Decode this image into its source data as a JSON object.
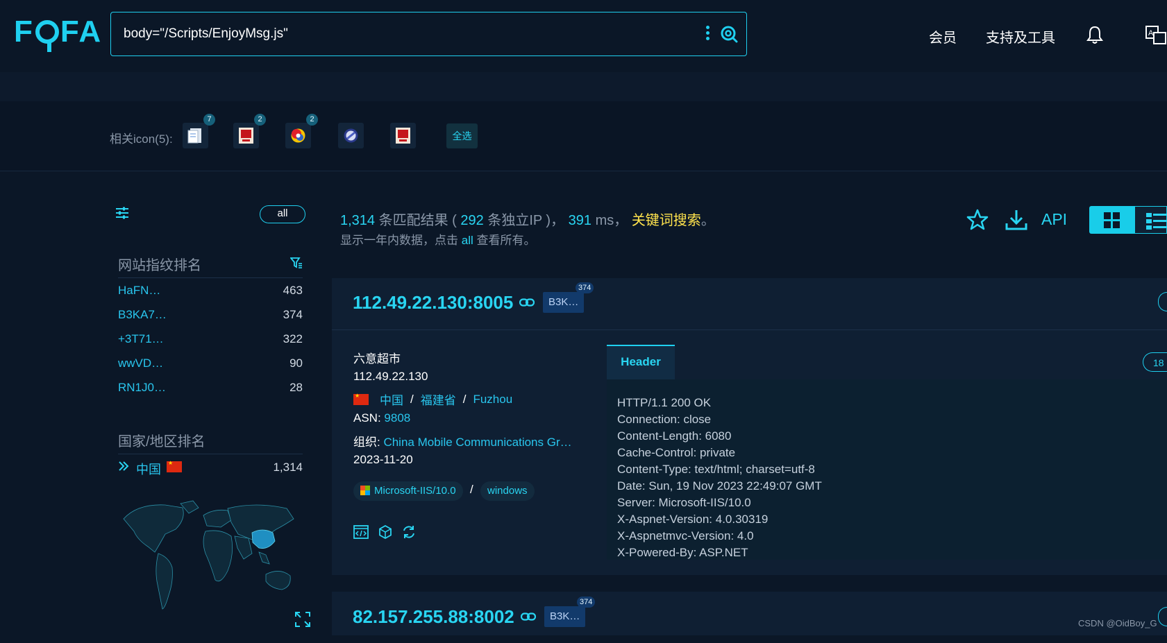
{
  "brand": {
    "logo_text_pre": "F",
    "logo_text_post": "FA"
  },
  "search": {
    "query": "body=\"/Scripts/EnjoyMsg.js\""
  },
  "nav": {
    "member": "会员",
    "tools": "支持及工具"
  },
  "related_icons": {
    "label": "相关icon(5):",
    "items": [
      {
        "name": "document-icon",
        "count": "7"
      },
      {
        "name": "red-stamp-icon",
        "count": "2"
      },
      {
        "name": "color-ring-icon",
        "count": "2"
      },
      {
        "name": "blue-circle-icon",
        "count": ""
      },
      {
        "name": "red-stamp-icon-2",
        "count": ""
      }
    ],
    "select_all": "全选"
  },
  "sidebar": {
    "all_label": "all",
    "fingerprint_title": "网站指纹排名",
    "fingerprints": [
      {
        "name": "HaFN…",
        "count": "463"
      },
      {
        "name": "B3KA7…",
        "count": "374"
      },
      {
        "name": "+3T71…",
        "count": "322"
      },
      {
        "name": "wwVD…",
        "count": "90"
      },
      {
        "name": "RN1J0…",
        "count": "28"
      }
    ],
    "country_title": "国家/地区排名",
    "country": {
      "name": "中国",
      "count": "1,314"
    }
  },
  "summary": {
    "total": "1,314",
    "total_suffix": " 条匹配结果 ( ",
    "unique_ip": "292",
    "unique_suffix": " 条独立IP )， ",
    "ms": "391",
    "ms_suffix": " ms， ",
    "keyword": "关键词搜索",
    "end": "。",
    "note_pre": "显示一年内数据，点击 ",
    "note_all": "all",
    "note_post": " 查看所有。",
    "api": "API"
  },
  "results": [
    {
      "host": "112.49.22.130:8005",
      "tag": "B3K…",
      "tag_count": "374",
      "title": "六意超市",
      "ip": "112.49.22.130",
      "country": "中国",
      "province": "福建省",
      "city": "Fuzhou",
      "sep": "/",
      "asn_label": "ASN: ",
      "asn": "9808",
      "org_label": "组织: ",
      "org": "China Mobile Communications Gr…",
      "date": "2023-11-20",
      "server": "Microsoft-IIS/10.0",
      "os": "windows",
      "header_tab": "Header",
      "header_count": "18",
      "header": "HTTP/1.1 200 OK\nConnection: close\nContent-Length: 6080\nCache-Control: private\nContent-Type: text/html; charset=utf-8\nDate: Sun, 19 Nov 2023 22:49:07 GMT\nServer: Microsoft-IIS/10.0\nX-Aspnet-Version: 4.0.30319\nX-Aspnetmvc-Version: 4.0\nX-Powered-By: ASP.NET"
    },
    {
      "host": "82.157.255.88:8002",
      "tag": "B3K…",
      "tag_count": "374"
    }
  ],
  "watermark": "CSDN @OidBoy_G",
  "colors": {
    "accent": "#1fd0f0",
    "background": "#0b1727",
    "keyword": "#ffe34d",
    "tag": "#123a6b"
  }
}
